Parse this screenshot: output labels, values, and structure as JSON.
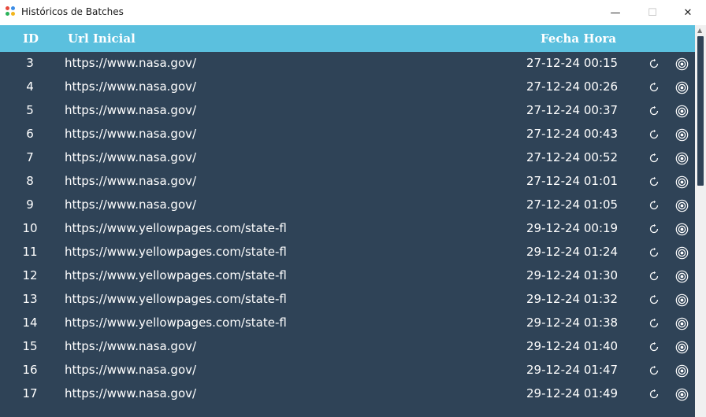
{
  "window": {
    "title": "Históricos de Batches",
    "controls": {
      "minimize": "—",
      "maximize": "☐",
      "close": "✕"
    }
  },
  "table": {
    "headers": {
      "id": "ID",
      "url": "Url Inicial",
      "fecha": "Fecha Hora"
    },
    "rows": [
      {
        "id": "3",
        "url": "https://www.nasa.gov/",
        "fecha": "27-12-24 00:15"
      },
      {
        "id": "4",
        "url": "https://www.nasa.gov/",
        "fecha": "27-12-24 00:26"
      },
      {
        "id": "5",
        "url": "https://www.nasa.gov/",
        "fecha": "27-12-24 00:37"
      },
      {
        "id": "6",
        "url": "https://www.nasa.gov/",
        "fecha": "27-12-24 00:43"
      },
      {
        "id": "7",
        "url": "https://www.nasa.gov/",
        "fecha": "27-12-24 00:52"
      },
      {
        "id": "8",
        "url": "https://www.nasa.gov/",
        "fecha": "27-12-24 01:01"
      },
      {
        "id": "9",
        "url": "https://www.nasa.gov/",
        "fecha": "27-12-24 01:05"
      },
      {
        "id": "10",
        "url": "https://www.yellowpages.com/state-fl",
        "fecha": "29-12-24 00:19"
      },
      {
        "id": "11",
        "url": "https://www.yellowpages.com/state-fl",
        "fecha": "29-12-24 01:24"
      },
      {
        "id": "12",
        "url": "https://www.yellowpages.com/state-fl",
        "fecha": "29-12-24 01:30"
      },
      {
        "id": "13",
        "url": "https://www.yellowpages.com/state-fl",
        "fecha": "29-12-24 01:32"
      },
      {
        "id": "14",
        "url": "https://www.yellowpages.com/state-fl",
        "fecha": "29-12-24 01:38"
      },
      {
        "id": "15",
        "url": "https://www.nasa.gov/",
        "fecha": "29-12-24 01:40"
      },
      {
        "id": "16",
        "url": "https://www.nasa.gov/",
        "fecha": "29-12-24 01:47"
      },
      {
        "id": "17",
        "url": "https://www.nasa.gov/",
        "fecha": "29-12-24 01:49"
      }
    ],
    "row_actions": [
      "reload-icon",
      "eye-icon"
    ]
  },
  "colors": {
    "header_bg": "#5bc0de",
    "body_bg": "#2f4357",
    "text": "#ffffff"
  }
}
